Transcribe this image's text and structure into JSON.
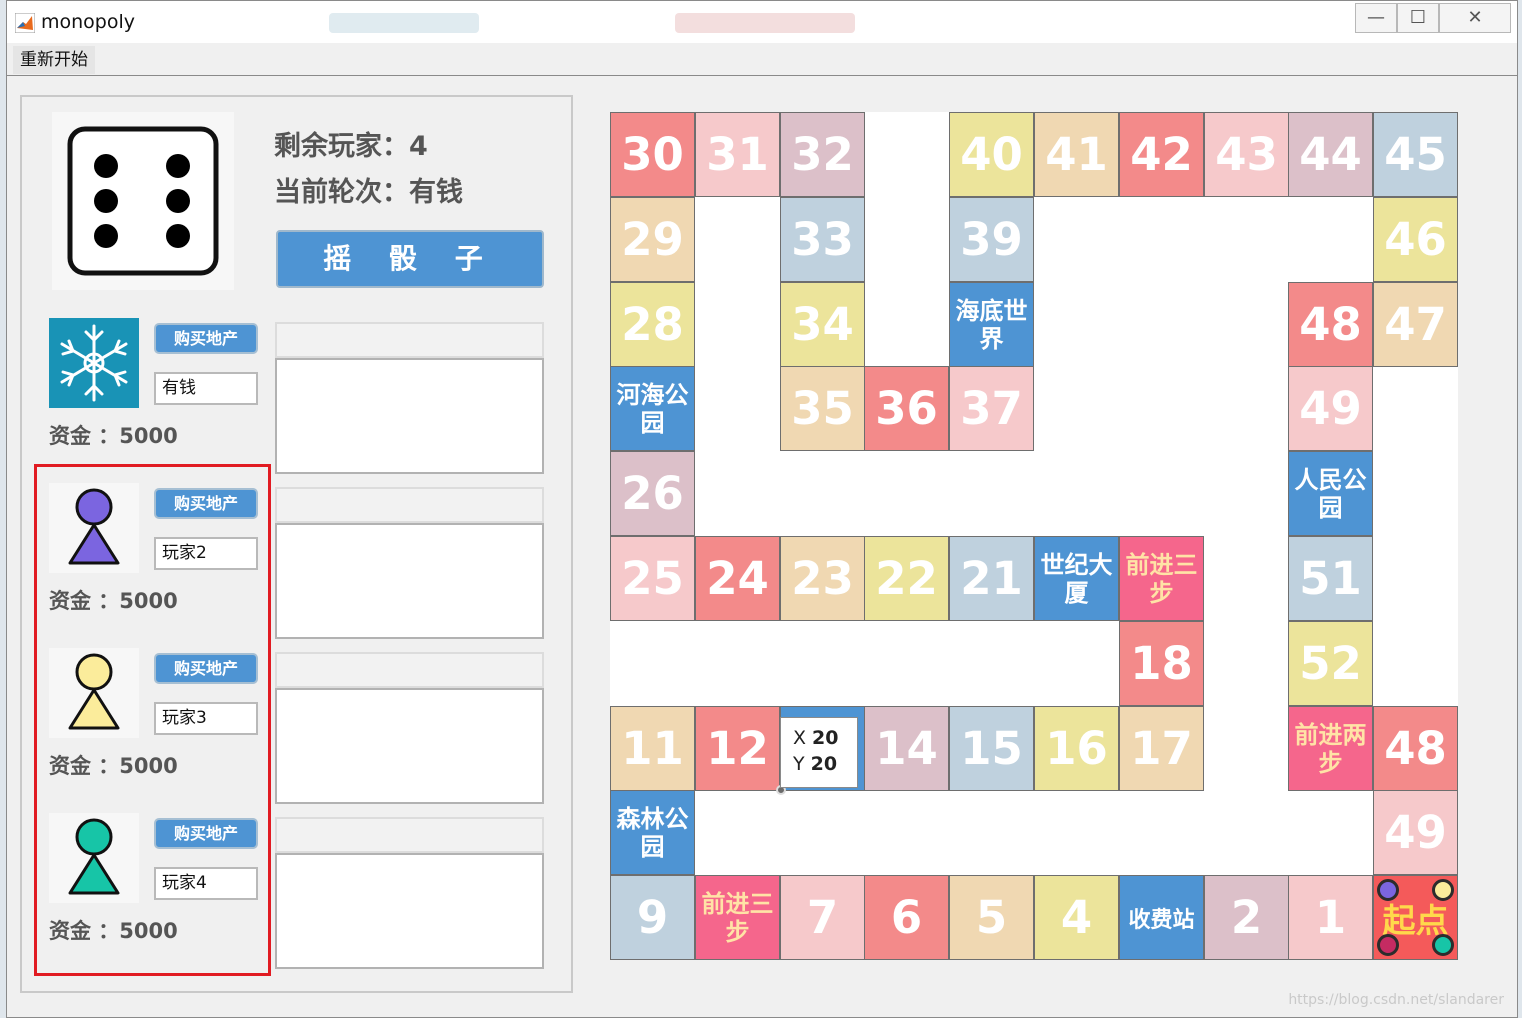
{
  "window": {
    "title": "monopoly",
    "controls": {
      "minimize": "—",
      "maximize": "☐",
      "close": "✕"
    }
  },
  "menu": {
    "restart": "重新开始"
  },
  "game": {
    "remaining_players": "剩余玩家：4",
    "current_turn": "当前轮次：有钱",
    "roll_button": "摇 骰 子",
    "dice_value": 6
  },
  "players": [
    {
      "avatar": "snowflake-icon",
      "name": "有钱",
      "buy_label": "购买地产",
      "money_label": "资金 ：5000",
      "color": "#1993b6"
    },
    {
      "avatar": "pawn-icon",
      "name": "玩家2",
      "buy_label": "购买地产",
      "money_label": "资金 ：5000",
      "color": "#7b65e0"
    },
    {
      "avatar": "pawn-icon",
      "name": "玩家3",
      "buy_label": "购买地产",
      "money_label": "资金 ：5000",
      "color": "#fbec9b"
    },
    {
      "avatar": "pawn-icon",
      "name": "玩家4",
      "buy_label": "购买地产",
      "money_label": "资金 ：5000",
      "color": "#17c5a7"
    }
  ],
  "board": {
    "tile_colors": {
      "red": "#f38a8a",
      "pink": "#f6c9cb",
      "mauve": "#dcc0c9",
      "peach": "#f0d8b2",
      "yellow": "#ece49b",
      "gray": "#bfd1de",
      "blue": "#4e94d3",
      "hot": "#f5668c",
      "start": "#f45a5a"
    },
    "tiles": [
      {
        "label": "30",
        "style": "num",
        "color": "red",
        "col": 0,
        "row": 0
      },
      {
        "label": "31",
        "style": "num",
        "color": "pink",
        "col": 1,
        "row": 0
      },
      {
        "label": "32",
        "style": "num",
        "color": "mauve",
        "col": 2,
        "row": 0
      },
      {
        "label": "40",
        "style": "num",
        "color": "yellow",
        "col": 4,
        "row": 0
      },
      {
        "label": "41",
        "style": "num",
        "color": "peach",
        "col": 5,
        "row": 0
      },
      {
        "label": "42",
        "style": "num",
        "color": "red",
        "col": 6,
        "row": 0
      },
      {
        "label": "43",
        "style": "num",
        "color": "pink",
        "col": 7,
        "row": 0
      },
      {
        "label": "44",
        "style": "num",
        "color": "mauve",
        "col": 8,
        "row": 0
      },
      {
        "label": "45",
        "style": "num",
        "color": "gray",
        "col": 9,
        "row": 0
      },
      {
        "label": "29",
        "style": "num",
        "color": "peach",
        "col": 0,
        "row": 1
      },
      {
        "label": "33",
        "style": "num",
        "color": "gray",
        "col": 2,
        "row": 1
      },
      {
        "label": "39",
        "style": "num",
        "color": "gray",
        "col": 4,
        "row": 1
      },
      {
        "label": "46",
        "style": "num",
        "color": "yellow",
        "col": 9,
        "row": 1
      },
      {
        "label": "28",
        "style": "num",
        "color": "yellow",
        "col": 0,
        "row": 2
      },
      {
        "label": "34",
        "style": "num",
        "color": "yellow",
        "col": 2,
        "row": 2
      },
      {
        "label": "海底世界",
        "style": "name",
        "color": "blue",
        "col": 4,
        "row": 2
      },
      {
        "label": "48",
        "style": "num",
        "color": "red",
        "col": 8,
        "row": 2
      },
      {
        "label": "47",
        "style": "num",
        "color": "peach",
        "col": 9,
        "row": 2
      },
      {
        "label": "河海公园",
        "style": "name",
        "color": "blue",
        "col": 0,
        "row": 3
      },
      {
        "label": "35",
        "style": "num",
        "color": "peach",
        "col": 2,
        "row": 3
      },
      {
        "label": "36",
        "style": "num",
        "color": "red",
        "col": 3,
        "row": 3
      },
      {
        "label": "37",
        "style": "num",
        "color": "pink",
        "col": 4,
        "row": 3
      },
      {
        "label": "49",
        "style": "num",
        "color": "pink",
        "col": 8,
        "row": 3
      },
      {
        "label": "26",
        "style": "num",
        "color": "mauve",
        "col": 0,
        "row": 4
      },
      {
        "label": "人民公园",
        "style": "name",
        "color": "blue",
        "col": 8,
        "row": 4
      },
      {
        "label": "25",
        "style": "num",
        "color": "pink",
        "col": 0,
        "row": 5
      },
      {
        "label": "24",
        "style": "num",
        "color": "red",
        "col": 1,
        "row": 5
      },
      {
        "label": "23",
        "style": "num",
        "color": "peach",
        "col": 2,
        "row": 5
      },
      {
        "label": "22",
        "style": "num",
        "color": "yellow",
        "col": 3,
        "row": 5
      },
      {
        "label": "21",
        "style": "num",
        "color": "gray",
        "col": 4,
        "row": 5
      },
      {
        "label": "世纪大厦",
        "style": "name",
        "color": "blue",
        "col": 5,
        "row": 5
      },
      {
        "label": "前进三步",
        "style": "ask",
        "color": "hot",
        "col": 6,
        "row": 5
      },
      {
        "label": "51",
        "style": "num",
        "color": "gray",
        "col": 8,
        "row": 5
      },
      {
        "label": "18",
        "style": "num",
        "color": "red",
        "col": 6,
        "row": 6
      },
      {
        "label": "52",
        "style": "num",
        "color": "yellow",
        "col": 8,
        "row": 6
      },
      {
        "label": "11",
        "style": "num",
        "color": "peach",
        "col": 0,
        "row": 7
      },
      {
        "label": "12",
        "style": "num",
        "color": "red",
        "col": 1,
        "row": 7
      },
      {
        "label": "",
        "style": "num",
        "color": "blue",
        "col": 2,
        "row": 7
      },
      {
        "label": "14",
        "style": "num",
        "color": "mauve",
        "col": 3,
        "row": 7
      },
      {
        "label": "15",
        "style": "num",
        "color": "gray",
        "col": 4,
        "row": 7
      },
      {
        "label": "16",
        "style": "num",
        "color": "yellow",
        "col": 5,
        "row": 7
      },
      {
        "label": "17",
        "style": "num",
        "color": "peach",
        "col": 6,
        "row": 7
      },
      {
        "label": "前进两步",
        "style": "ask",
        "color": "hot",
        "col": 8,
        "row": 7
      },
      {
        "label": "48",
        "style": "num",
        "color": "red",
        "col": 9,
        "row": 7
      },
      {
        "label": "森林公园",
        "style": "name",
        "color": "blue",
        "col": 0,
        "row": 8
      },
      {
        "label": "49",
        "style": "num",
        "color": "pink",
        "col": 9,
        "row": 8
      },
      {
        "label": "9",
        "style": "num",
        "color": "gray",
        "col": 0,
        "row": 9
      },
      {
        "label": "前进三步",
        "style": "ask",
        "color": "hot",
        "col": 1,
        "row": 9
      },
      {
        "label": "7",
        "style": "num",
        "color": "pink",
        "col": 2,
        "row": 9
      },
      {
        "label": "6",
        "style": "num",
        "color": "red",
        "col": 3,
        "row": 9
      },
      {
        "label": "5",
        "style": "num",
        "color": "peach",
        "col": 4,
        "row": 9
      },
      {
        "label": "4",
        "style": "num",
        "color": "yellow",
        "col": 5,
        "row": 9
      },
      {
        "label": "收费站",
        "style": "name4",
        "color": "blue",
        "col": 6,
        "row": 9
      },
      {
        "label": "2",
        "style": "num",
        "color": "mauve",
        "col": 7,
        "row": 9
      },
      {
        "label": "1",
        "style": "num",
        "color": "pink",
        "col": 8,
        "row": 9
      },
      {
        "label": "起点",
        "style": "start",
        "color": "start",
        "col": 9,
        "row": 9
      }
    ],
    "tokens": [
      "#7b65e0",
      "#fbec9b",
      "#c52b62",
      "#17c5a7"
    ]
  },
  "datatip": {
    "x_label": "X",
    "x_value": "20",
    "y_label": "Y",
    "y_value": "20"
  },
  "watermark": "https://blog.csdn.net/slandarer"
}
